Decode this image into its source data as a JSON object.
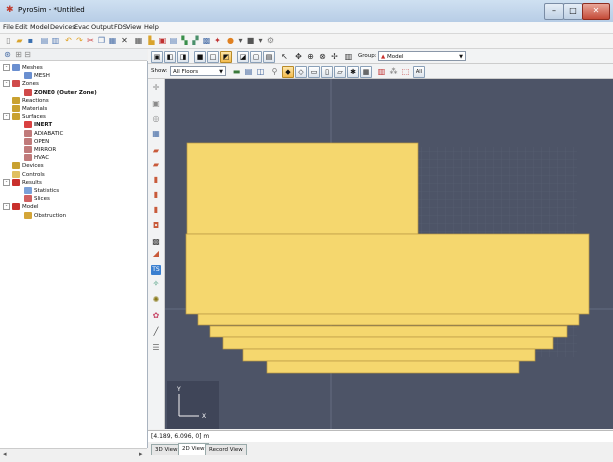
{
  "window": {
    "title": "PyroSim - *Untitled",
    "app_icon": "pyrosim-logo-icon",
    "controls": [
      "minimize-icon",
      "maximize-icon",
      "close-icon"
    ]
  },
  "menu": [
    "File",
    "Edit",
    "Model",
    "Devices",
    "Evac",
    "Output",
    "FDS",
    "View",
    "Help"
  ],
  "tree": {
    "items": [
      {
        "label": "Meshes",
        "depth": 0,
        "bold": false,
        "expander": "-",
        "icon": "meshes-icon",
        "color": "#6a8fd0"
      },
      {
        "label": "MESH",
        "depth": 1,
        "bold": false,
        "expander": "",
        "icon": "mesh-icon",
        "color": "#6a8fd0"
      },
      {
        "label": "Zones",
        "depth": 0,
        "bold": false,
        "expander": "-",
        "icon": "zones-icon",
        "color": "#d04a4a"
      },
      {
        "label": "ZONE0 (Outer Zone)",
        "depth": 1,
        "bold": true,
        "expander": "",
        "icon": "zone-icon",
        "color": "#d04a4a"
      },
      {
        "label": "Reactions",
        "depth": 0,
        "bold": false,
        "expander": "",
        "icon": "reactions-icon",
        "color": "#c9a130"
      },
      {
        "label": "Materials",
        "depth": 0,
        "bold": false,
        "expander": "",
        "icon": "materials-icon",
        "color": "#c9a130"
      },
      {
        "label": "Surfaces",
        "depth": 0,
        "bold": false,
        "expander": "-",
        "icon": "surfaces-icon",
        "color": "#c9a130"
      },
      {
        "label": "INERT",
        "depth": 1,
        "bold": true,
        "expander": "",
        "icon": "surface-icon",
        "color": "#d94040"
      },
      {
        "label": "ADIABATIC",
        "depth": 1,
        "bold": false,
        "expander": "",
        "icon": "surface-icon",
        "color": "#c07a7a"
      },
      {
        "label": "OPEN",
        "depth": 1,
        "bold": false,
        "expander": "",
        "icon": "surface-icon",
        "color": "#c07a7a"
      },
      {
        "label": "MIRROR",
        "depth": 1,
        "bold": false,
        "expander": "",
        "icon": "surface-icon",
        "color": "#c07a7a"
      },
      {
        "label": "HVAC",
        "depth": 1,
        "bold": false,
        "expander": "",
        "icon": "surface-icon",
        "color": "#c07a7a"
      },
      {
        "label": "Devices",
        "depth": 0,
        "bold": false,
        "expander": "",
        "icon": "devices-icon",
        "color": "#c9a130"
      },
      {
        "label": "Controls",
        "depth": 0,
        "bold": false,
        "expander": "",
        "icon": "controls-icon",
        "color": "#e0c060"
      },
      {
        "label": "Results",
        "depth": 0,
        "bold": false,
        "expander": "-",
        "icon": "results-icon",
        "color": "#c9302c"
      },
      {
        "label": "Statistics",
        "depth": 1,
        "bold": false,
        "expander": "",
        "icon": "statistics-icon",
        "color": "#7aa0d8"
      },
      {
        "label": "Slices",
        "depth": 1,
        "bold": false,
        "expander": "",
        "icon": "slices-icon",
        "color": "#d06060"
      },
      {
        "label": "Model",
        "depth": 0,
        "bold": false,
        "expander": "-",
        "icon": "model-icon",
        "color": "#c9302c"
      },
      {
        "label": "Obstruction",
        "depth": 1,
        "bold": false,
        "expander": "",
        "icon": "obstruction-icon",
        "color": "#d4a537"
      }
    ]
  },
  "view": {
    "show_label": "Show:",
    "show_value": "All Floors",
    "group_label": "Group:",
    "group_value": "Model",
    "coords": "[4.189, 6.096, 0] m",
    "tabs": [
      "3D View",
      "2D View",
      "Record View"
    ],
    "active_tab": 1,
    "axis_x": "X",
    "axis_y": "Y"
  },
  "colors": {
    "canvas": "#4d5467",
    "obstruction": "#f5d76e",
    "obstruction_edge": "#a88a3a",
    "grid": "#5e6578"
  }
}
